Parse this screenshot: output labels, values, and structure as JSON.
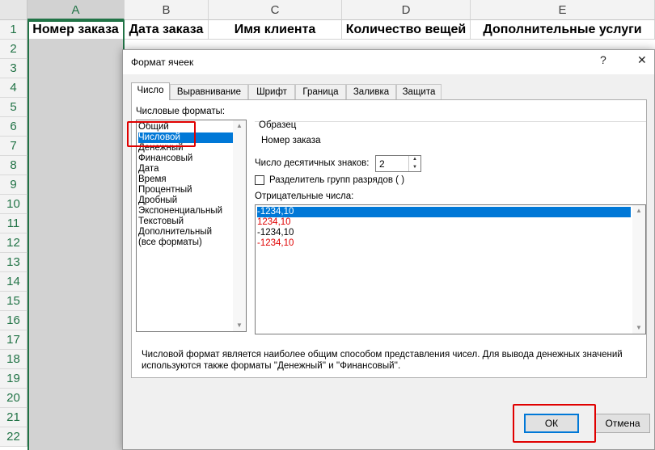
{
  "spreadsheet": {
    "columns": [
      "A",
      "B",
      "C",
      "D",
      "E"
    ],
    "rows": [
      "1",
      "2",
      "3",
      "4",
      "5",
      "6",
      "7",
      "8",
      "9",
      "10",
      "11",
      "12",
      "13",
      "14",
      "15",
      "16",
      "17",
      "18",
      "19",
      "20",
      "21",
      "22"
    ],
    "headers": [
      "Номер заказа",
      "Дата заказа",
      "Имя клиента",
      "Количество вещей",
      "Дополнительные услуги"
    ]
  },
  "dialog": {
    "title": "Формат ячеек",
    "help_icon": "?",
    "close_icon": "✕",
    "tabs": [
      "Число",
      "Выравнивание",
      "Шрифт",
      "Граница",
      "Заливка",
      "Защита"
    ],
    "active_tab": "Число",
    "formats_label": "Числовые форматы:",
    "formats": [
      "Общий",
      "Числовой",
      "Денежный",
      "Финансовый",
      "Дата",
      "Время",
      "Процентный",
      "Дробный",
      "Экспоненциальный",
      "Текстовый",
      "Дополнительный",
      "(все форматы)"
    ],
    "selected_format": "Числовой",
    "sample_label": "Образец",
    "sample_value": "Номер заказа",
    "decimals_label": "Число десятичных знаков:",
    "decimals_value": "2",
    "separator_label": "Разделитель групп разрядов ( )",
    "separator_checked": false,
    "negative_label": "Отрицательные числа:",
    "negative_options": [
      {
        "text": "-1234,10",
        "color": "#000000",
        "selected": true
      },
      {
        "text": "1234,10",
        "color": "#e00000",
        "selected": false
      },
      {
        "text": "-1234,10",
        "color": "#000000",
        "selected": false
      },
      {
        "text": "-1234,10",
        "color": "#e00000",
        "selected": false
      }
    ],
    "description": "Числовой формат является наиболее общим способом представления чисел. Для вывода денежных значений используются также форматы ''Денежный'' и ''Финансовый''.",
    "ok_label": "ОК",
    "cancel_label": "Отмена"
  },
  "colors": {
    "accent": "#217346",
    "selection": "#0078d7",
    "highlight": "#e00000"
  }
}
